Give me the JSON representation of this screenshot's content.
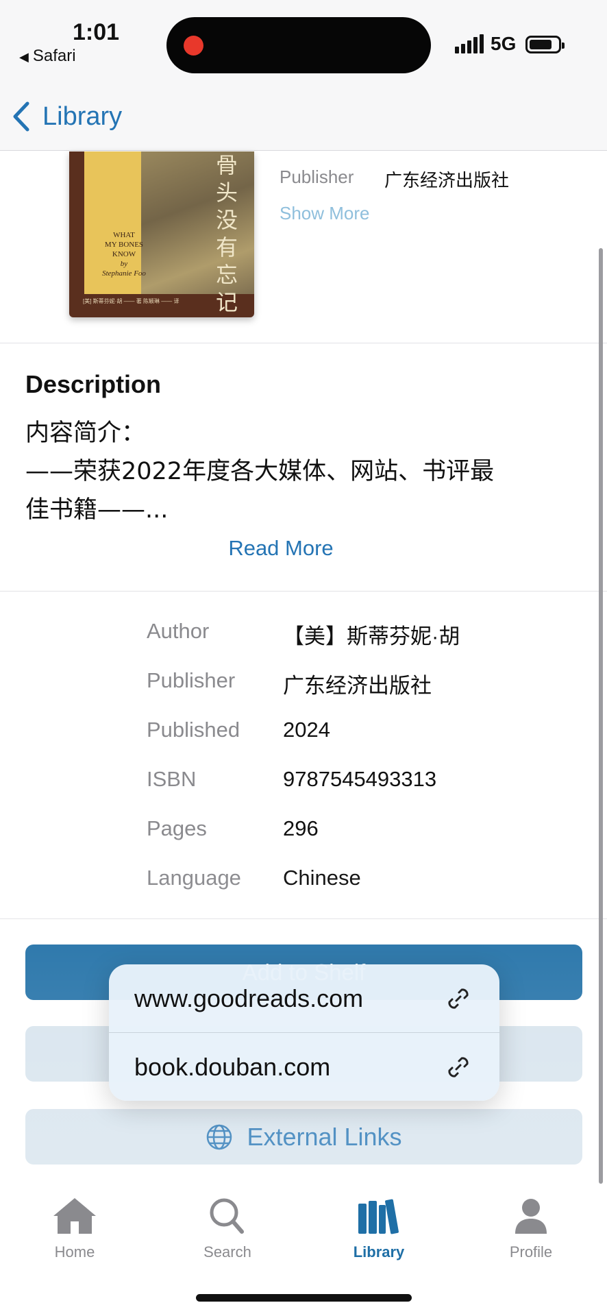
{
  "status_bar": {
    "time": "1:01",
    "back_app": "Safari",
    "network": "5G"
  },
  "nav": {
    "back_label": "Library"
  },
  "cover": {
    "title_cn": "骨头没有忘记",
    "title_en_line1": "WHAT",
    "title_en_line2": "MY BONES",
    "title_en_line3": "KNOW",
    "by": "by",
    "author_en": "Stephanie Foo",
    "footer": "[美] 斯蒂芬妮·胡 —— 著   陈颖琳 —— 译"
  },
  "header_meta": {
    "publisher_label": "Publisher",
    "publisher_value": "广东经济出版社",
    "show_more": "Show More"
  },
  "description": {
    "title": "Description",
    "line1": "内容简介：",
    "line2": "——荣获2022年度各大媒体、网站、书评最",
    "line3": "佳书籍——...",
    "read_more": "Read More"
  },
  "details": [
    {
      "label": "Author",
      "value": "【美】斯蒂芬妮·胡"
    },
    {
      "label": "Publisher",
      "value": "广东经济出版社"
    },
    {
      "label": "Published",
      "value": "2024"
    },
    {
      "label": "ISBN",
      "value": "9787545493313"
    },
    {
      "label": "Pages",
      "value": "296"
    },
    {
      "label": "Language",
      "value": "Chinese"
    }
  ],
  "buttons": {
    "primary_label": "Add to Shelf",
    "external_links": "External Links"
  },
  "popup": {
    "items": [
      {
        "label": "www.goodreads.com",
        "icon": "link-icon"
      },
      {
        "label": "book.douban.com",
        "icon": "link-icon"
      }
    ]
  },
  "tabs": [
    {
      "label": "Home",
      "icon": "home-icon",
      "active": false
    },
    {
      "label": "Search",
      "icon": "search-icon",
      "active": false
    },
    {
      "label": "Library",
      "icon": "books-icon",
      "active": true
    },
    {
      "label": "Profile",
      "icon": "person-icon",
      "active": false
    }
  ],
  "colors": {
    "accent": "#2474b4",
    "primary_button": "#1f6fa6",
    "secondary_button": "#d6e3ed",
    "inactive_tab": "#8a8a8e"
  }
}
